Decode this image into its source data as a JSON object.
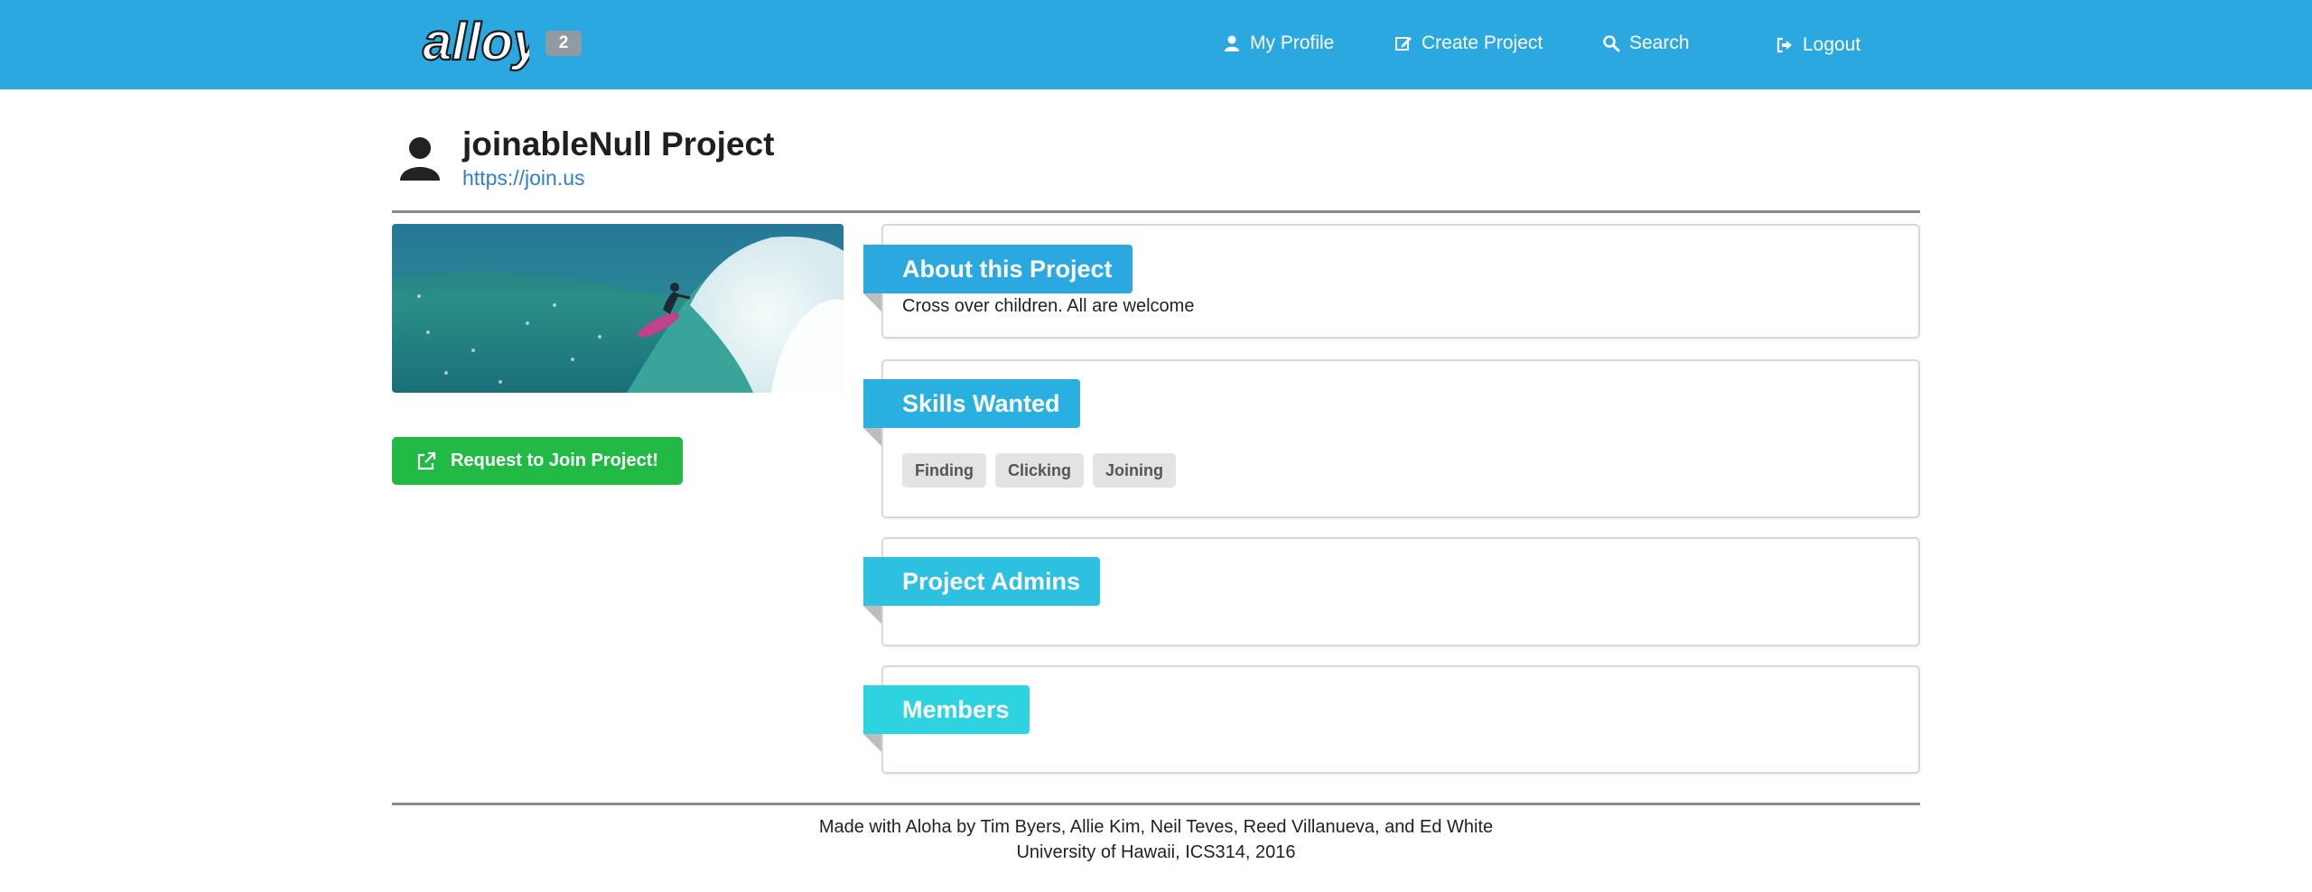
{
  "navbar": {
    "brand": "alloy",
    "badge_count": "2",
    "items": [
      {
        "label": "My Profile",
        "icon": "user-icon"
      },
      {
        "label": "Create Project",
        "icon": "edit-icon"
      },
      {
        "label": "Search",
        "icon": "search-icon"
      },
      {
        "label": "Logout",
        "icon": "sign-out-icon"
      }
    ]
  },
  "project": {
    "title": "joinableNull Project",
    "url": "https://join.us",
    "join_button": "Request to Join Project!",
    "image_alt": "surfer riding a wave"
  },
  "sections": {
    "about": {
      "heading": "About this Project",
      "text": "Cross over children. All are welcome"
    },
    "skills": {
      "heading": "Skills Wanted",
      "items": [
        "Finding",
        "Clicking",
        "Joining"
      ]
    },
    "admins": {
      "heading": "Project Admins"
    },
    "members": {
      "heading": "Members"
    }
  },
  "footer": {
    "line1": "Made with Aloha by Tim Byers, Allie Kim, Neil Teves, Reed Villanueva, and Ed White",
    "line2": "University of Hawaii, ICS314, 2016"
  },
  "colors": {
    "navbar": "#2aa8df",
    "join_button": "#21ba45",
    "ribbon_about": "#2aa8df",
    "ribbon_skills": "#2ab0e0",
    "ribbon_admins": "#2ec0e0",
    "ribbon_members": "#2ed3e0",
    "link": "#2f7fcf"
  }
}
